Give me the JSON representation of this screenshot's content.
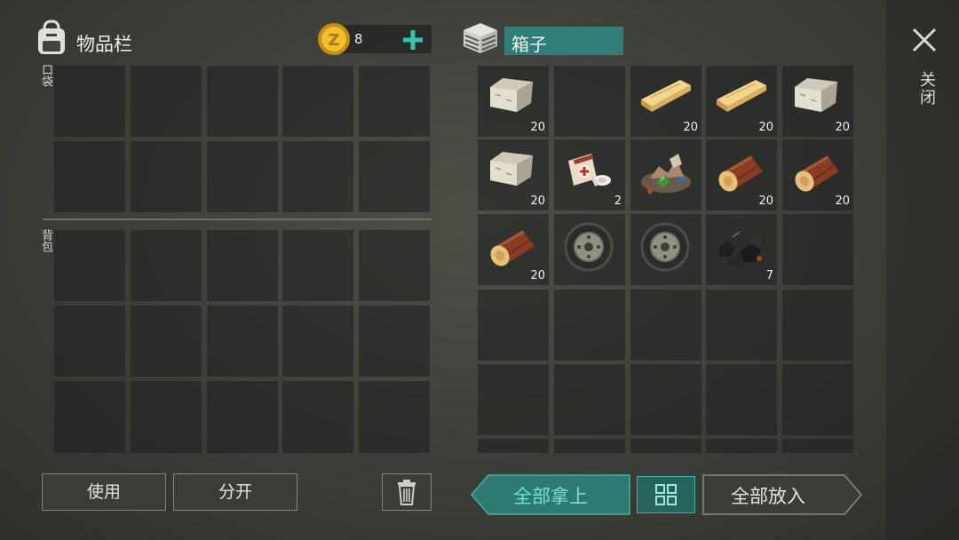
{
  "inventory": {
    "title": "物品栏",
    "coin_count": "8",
    "pocket_label": "口袋",
    "backpack_label": "背包"
  },
  "container": {
    "title": "箱子",
    "items": [
      {
        "name": "stone-block",
        "count": "20"
      },
      {
        "name": "empty",
        "count": ""
      },
      {
        "name": "wood-plank",
        "count": "20"
      },
      {
        "name": "wood-plank",
        "count": "20"
      },
      {
        "name": "stone-block",
        "count": "20"
      },
      {
        "name": "stone-block",
        "count": "20"
      },
      {
        "name": "bandage",
        "count": "2"
      },
      {
        "name": "scrap-pile",
        "count": ""
      },
      {
        "name": "log",
        "count": "20"
      },
      {
        "name": "log",
        "count": "20"
      },
      {
        "name": "log",
        "count": "20"
      },
      {
        "name": "tire",
        "count": ""
      },
      {
        "name": "tire",
        "count": ""
      },
      {
        "name": "coal",
        "count": "7"
      },
      {
        "name": "empty",
        "count": ""
      }
    ]
  },
  "side": {
    "close_label": "关闭"
  },
  "buttons": {
    "use": "使用",
    "split": "分开",
    "take_all": "全部拿上",
    "put_all": "全部放入"
  },
  "colors": {
    "accent": "#2f7f78",
    "accent_bright": "#38c2b0",
    "coin": "#e8b021"
  }
}
